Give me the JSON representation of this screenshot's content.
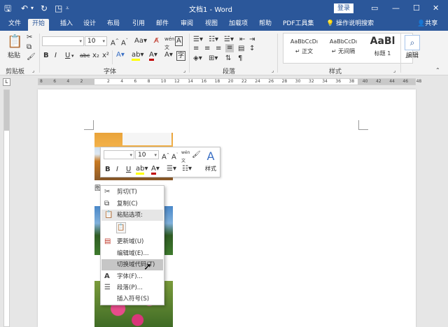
{
  "titlebar": {
    "title": "文档1 - Word",
    "login": "登录"
  },
  "tabs": [
    {
      "label": "文件"
    },
    {
      "label": "开始"
    },
    {
      "label": "插入"
    },
    {
      "label": "设计"
    },
    {
      "label": "布局"
    },
    {
      "label": "引用"
    },
    {
      "label": "邮件"
    },
    {
      "label": "审阅"
    },
    {
      "label": "视图"
    },
    {
      "label": "加载项"
    },
    {
      "label": "帮助"
    },
    {
      "label": "PDF工具集"
    }
  ],
  "tell_me": "操作说明搜索",
  "share": "共享",
  "ribbon": {
    "paste_label": "粘贴",
    "clipboard_group": "剪贴板",
    "font_name": "",
    "font_size": "10",
    "font_group": "字体",
    "paragraph_group": "段落",
    "styles_group": "样式",
    "styles": [
      {
        "sample": "AaBbCcDı",
        "name": "↵ 正文"
      },
      {
        "sample": "AaBbCcDı",
        "name": "↵ 无间隔"
      },
      {
        "sample": "AaBl",
        "name": "标题 1"
      }
    ],
    "edit_label": "编辑"
  },
  "ruler": {
    "numbers": [
      "8",
      "6",
      "4",
      "2",
      "2",
      "4",
      "6",
      "8",
      "10",
      "12",
      "14",
      "16",
      "18",
      "20",
      "22",
      "24",
      "26",
      "28",
      "30",
      "32",
      "34",
      "36",
      "38",
      "40",
      "42",
      "44",
      "46",
      "48"
    ]
  },
  "caption": "图",
  "mini_toolbar": {
    "font_size": "10",
    "style_label": "样式"
  },
  "context_menu": {
    "items": [
      {
        "label": "剪切(T)",
        "icon": "scissors-icon"
      },
      {
        "label": "复制(C)",
        "icon": "copy-icon"
      },
      {
        "label": "粘贴选项:",
        "icon": "paste-icon"
      },
      {
        "label": "更新域(U)",
        "icon": "update-field-icon"
      },
      {
        "label": "编辑域(E)...",
        "icon": ""
      },
      {
        "label": "切换域代码(T)",
        "icon": ""
      },
      {
        "label": "字体(F)...",
        "icon": "font-icon"
      },
      {
        "label": "段落(P)...",
        "icon": "paragraph-icon"
      },
      {
        "label": "插入符号(S)",
        "icon": ""
      }
    ]
  },
  "colors": {
    "accent": "#2b579a",
    "highlight": "#ffff00",
    "font_color": "#c00000"
  }
}
